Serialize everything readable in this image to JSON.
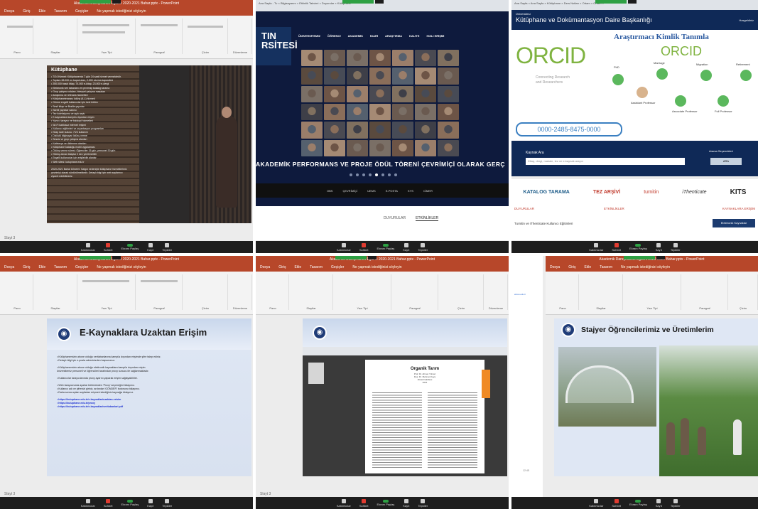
{
  "zoom_toolbar": {
    "items": [
      "Katılımcılar",
      "Sohbet",
      "Ekranı Paylaş",
      "Kayıt",
      "Tepkiler"
    ]
  },
  "tile1": {
    "pp_title": "Akademik Danışmanlık Eğitimi 2020-2021 Bahar.pptx - PowerPoint",
    "tabs": [
      "Dosya",
      "Giriş",
      "Ekle",
      "Tasarım",
      "Geçişler",
      "Animasyonlar",
      "Slayt Gösterisi",
      "Gözden Geçir",
      "Görünüm",
      "Ne yapmak istediğinizi söyleyin"
    ],
    "ribbon_groups": [
      "Pano",
      "Slaytlar",
      "Yazı Tipi",
      "Paragraf",
      "Çizim",
      "Düzenleme"
    ],
    "status": "Slayt 3",
    "slide_title": "Kütüphane",
    "slide_lines": [
      "• 7/24 Hizmet: Kütüphanemiz 7 gün 24 saat hizmet vermektedir.",
      "• Toplam 38.000 m² kapalı alan, 2.500 oturma kapasitesi",
      "• 250.000 basılı kitap, 74.000 e-kitap, 23.000 e-dergi",
      "• Elektronik veri tabanları ve çevrimiçi katalog tarama",
      "• Grup çalışma odaları, bireysel çalışma masaları",
      "• Araştırma ve referans hizmetleri",
      "• Kütüphanelerarası ödünç (ILL) hizmeti",
      "• Görme engelli kullanıcılar için özel bölüm",
      "• Sesli kitap ve Braille yayınlar",
      "• Süreli yayınlar salonu",
      "• Tez koleksiyonu ve açık arşiv",
      "• E-kaynaklara kampüs dışından erişim",
      "• Yazıcı, tarayıcı ve fotokopi hizmetleri",
      "• Wi-Fi kablosuz internet erişimi",
      "• Kullanıcı eğitimleri ve oryantasyon programları",
      "• Kitap iade kutusu: 7/24 kullanım",
      "• Dizüstü bilgisayar ödünç verme",
      "• Sessiz ve grup çalışma alanları",
      "• Kafeterya ve dinlenme alanları",
      "• Kütüphane kataloğu mobil uygulaması",
      "• Ödünç verme süresi: Öğrenciler 15 gün, personel 30 gün",
      "• Ödünç alınan kitaplar 2 kez yenilenebilir",
      "• Engelli kullanıcılar için erişilebilir alanlar",
      "• Web sitesi: kutuphane.edu.tr",
      "",
      "2020-2021 Bahar Dönemi: Salgın nedeniyle kütüphane hizmetlerimiz",
      "çevrimiçi olarak sürdürülmektedir. Detaylı bilgi için web sayfamızı",
      "ziyaret edebilirsiniz."
    ]
  },
  "tile2": {
    "browser_tabs": "Ana Sayfa - Tv  ×  Bilgisayarım  ×  Etkinlik Takvimi  ×  Duyurular  ×  Kütüphane",
    "logo_text": "TIN\nRSİTESİ",
    "nav": [
      "ÜNİVERSİTEMİZ",
      "ÖĞRENCİ",
      "AKADEMİK",
      "İDARİ",
      "ARAŞTIRMA",
      "KALİTE",
      "HIZLI ERİŞİM"
    ],
    "banner": "AKADEMİK PERFORMANS VE PROJE ÖDÜL TÖRENİ ÇEVRİMİÇİ OLARAK GERÇ",
    "footer_links": [
      "OBS",
      "ÇEVRİMİÇİ",
      "UEMS",
      "E-POSTA",
      "KYS",
      "CİMER"
    ],
    "tabs": [
      "DUYURULAR",
      "ETKİNLİKLER",
      "HABERLER"
    ]
  },
  "tile3": {
    "browser_tabs": "Ana Sayfa  ×  Ana Sayfa  ×  Kütüphane  ×  Ders Notları  ×  Ortam  ×  Ortam  ×",
    "uni": "Üniversitesi",
    "dept": "Kütüphane ve Dokümantasyon Daire Başkanlığı",
    "right_link": "Hosgeldiniz",
    "headline": "Araştırmacı Kimlik Tanımla",
    "orcid": "ORCID",
    "tagline": "Connecting Research\nand Researchers",
    "orcid_small": "ORCID",
    "career": [
      "PhD",
      "Marriage",
      "Migration",
      "Retirement",
      "Assistant Professor",
      "Associate Professor",
      "Full Professor"
    ],
    "orcid_id": "0000-2485-8475-0000",
    "search_title": "Kaynak Ara",
    "search_placeholder": "Kitap, dergi, makale, tez ve e-kaynak arayın",
    "search_option": "Arama Seçenekleri",
    "search_button": "ARA",
    "logos": [
      "KATALOG TARAMA",
      "TEZ ARŞİVİ",
      "turnitin",
      "iThenticate",
      "KITS"
    ],
    "news_head_left": "DUYURULAR",
    "news_head_mid": "ETKİNLİKLER",
    "news_head_right": "KAYNAKLARA ERİŞİM",
    "news_item": "Turnitin ve iThenticate Kullanıcı Eğitimleri",
    "news_button": "Elektronik Kaynaklar"
  },
  "tile4": {
    "slide_title": "E-Kaynaklara Uzaktan Erişim",
    "lines": [
      "• Kütüphanemizin abone olduğu veritabanlarına kampüs dışından erişimde şifre talep ediniz.",
      "• Detaylı bilgi için e-posta adresinizden başvurunuz.",
      "",
      "• Kütüphanemizin abone olduğu elektronik kaynaklara kampüs dışından erişim",
      "  üniversitemiz personeli ve öğrencileri tarafından proxy sunucu ile sağlanmaktadır.",
      "",
      "• Kullanıcılar tarayıcılarında proxy ayarını yaparak erişim sağlayabilirler.",
      "",
      "• Web tarayıcınızda ayarlar bölümünden 'Proxy' seçeneğini tıklayınız.",
      "• Kullanıcı adı ve şifrenizi giriniz, ardından 'GÖNDER' butonunu tıklayınız.",
      "• Daha sonra açılan sayfadan erişmek istediğiniz kaynağa tıklayınız.",
      "",
      "• https://kutuphane.edu.tr/e-kaynaklar/uzaktan-erisim",
      "• https://kutuphane.edu.tr/proxy",
      "• https://kutuphane.edu.tr/e-kaynaklar/veritabanlari.pdf"
    ]
  },
  "tile5": {
    "pdf_title": "Organik Tarım",
    "pdf_authors": "Prof. Dr. Ahmet Yılmaz\nDoç. Dr. Mehmet Kaya\nZiraat Fakültesi\n2021"
  },
  "tile6": {
    "side_text": "ekran.edu.tr",
    "side_bottom": "12:45",
    "slide_title": "Stajyer Öğrencilerimiz ve Üretimlerim"
  }
}
